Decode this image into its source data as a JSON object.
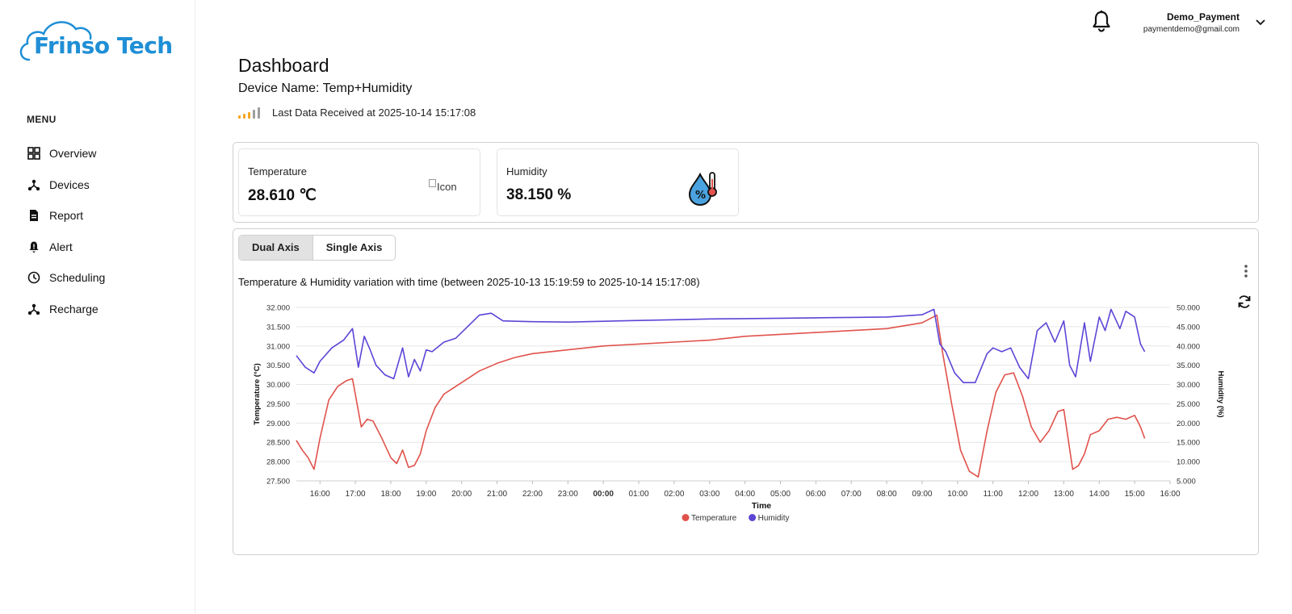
{
  "brand": {
    "name": "Frinso Tech",
    "color": "#1f8fd6"
  },
  "sidebar": {
    "menu_title": "MENU",
    "items": [
      {
        "label": "Overview",
        "icon": "grid-icon"
      },
      {
        "label": "Devices",
        "icon": "devices-icon"
      },
      {
        "label": "Report",
        "icon": "report-icon"
      },
      {
        "label": "Alert",
        "icon": "alert-icon"
      },
      {
        "label": "Scheduling",
        "icon": "clock-icon"
      },
      {
        "label": "Recharge",
        "icon": "recharge-icon"
      }
    ]
  },
  "header": {
    "user_name": "Demo_Payment",
    "user_email": "paymentdemo@gmail.com"
  },
  "main": {
    "title": "Dashboard",
    "device_name": "Device Name: Temp+Humidity",
    "last_data": "Last Data Received at 2025-10-14 15:17:08",
    "signal_colors": [
      "#f5a623",
      "#f5a623",
      "#f5a623",
      "#9e9e9e",
      "#9e9e9e"
    ]
  },
  "cards": [
    {
      "title": "Temperature",
      "value": "28.610 ℃",
      "icon_alt": "Icon"
    },
    {
      "title": "Humidity",
      "value": "38.150 %",
      "icon": "humidity-drop-icon"
    }
  ],
  "tabs": [
    {
      "label": "Dual Axis",
      "active": true
    },
    {
      "label": "Single Axis",
      "active": false
    }
  ],
  "chart_data": {
    "type": "line",
    "title": "Temperature & Humidity variation with time (between 2025-10-13 15:19:59 to 2025-10-14 15:17:08)",
    "xlabel": "Time",
    "ylabel_left": "Temperature (°C)",
    "ylabel_right": "Humidity (%)",
    "x_ticks": [
      "16:00",
      "17:00",
      "18:00",
      "19:00",
      "20:00",
      "21:00",
      "22:00",
      "23:00",
      "00:00",
      "01:00",
      "02:00",
      "03:00",
      "04:00",
      "05:00",
      "06:00",
      "07:00",
      "08:00",
      "09:00",
      "10:00",
      "11:00",
      "12:00",
      "13:00",
      "14:00",
      "15:00",
      "16:00"
    ],
    "y_left_ticks": [
      "32.000",
      "31.500",
      "31.000",
      "30.500",
      "30.000",
      "29.500",
      "29.000",
      "28.500",
      "28.000",
      "27.500"
    ],
    "y_right_ticks": [
      "50.000",
      "45.000",
      "40.000",
      "35.000",
      "30.000",
      "25.000",
      "20.000",
      "15.000",
      "10.000",
      "5.000"
    ],
    "ylim_left": [
      27.5,
      32.0
    ],
    "ylim_right": [
      5,
      50
    ],
    "xlim": [
      "2025-10-13 15:20",
      "2025-10-14 16:00"
    ],
    "grid": true,
    "legend_position": "bottom",
    "series": [
      {
        "name": "Temperature",
        "axis": "left",
        "color": "#e0524b",
        "x": [
          "2025-10-13 15:20",
          "2025-10-13 15:30",
          "2025-10-13 15:40",
          "2025-10-13 15:50",
          "2025-10-13 16:00",
          "2025-10-13 16:15",
          "2025-10-13 16:30",
          "2025-10-13 16:45",
          "2025-10-13 16:55",
          "2025-10-13 17:10",
          "2025-10-13 17:20",
          "2025-10-13 17:30",
          "2025-10-13 17:45",
          "2025-10-13 18:00",
          "2025-10-13 18:10",
          "2025-10-13 18:20",
          "2025-10-13 18:30",
          "2025-10-13 18:40",
          "2025-10-13 18:50",
          "2025-10-13 19:00",
          "2025-10-13 19:15",
          "2025-10-13 19:30",
          "2025-10-13 19:45",
          "2025-10-13 20:00",
          "2025-10-13 20:30",
          "2025-10-13 21:00",
          "2025-10-13 21:30",
          "2025-10-13 22:00",
          "2025-10-13 23:00",
          "2025-10-14 00:00",
          "2025-10-14 01:00",
          "2025-10-14 02:00",
          "2025-10-14 03:00",
          "2025-10-14 04:00",
          "2025-10-14 05:00",
          "2025-10-14 06:00",
          "2025-10-14 07:00",
          "2025-10-14 08:00",
          "2025-10-14 09:00",
          "2025-10-14 09:25",
          "2025-10-14 09:35",
          "2025-10-14 09:50",
          "2025-10-14 10:05",
          "2025-10-14 10:20",
          "2025-10-14 10:35",
          "2025-10-14 10:50",
          "2025-10-14 11:05",
          "2025-10-14 11:20",
          "2025-10-14 11:35",
          "2025-10-14 11:50",
          "2025-10-14 12:05",
          "2025-10-14 12:20",
          "2025-10-14 12:35",
          "2025-10-14 12:50",
          "2025-10-14 13:00",
          "2025-10-14 13:15",
          "2025-10-14 13:25",
          "2025-10-14 13:35",
          "2025-10-14 13:45",
          "2025-10-14 14:00",
          "2025-10-14 14:15",
          "2025-10-14 14:30",
          "2025-10-14 14:45",
          "2025-10-14 15:00",
          "2025-10-14 15:10",
          "2025-10-14 15:17"
        ],
        "values": [
          28.55,
          28.3,
          28.1,
          27.8,
          28.6,
          29.6,
          29.95,
          30.1,
          30.15,
          28.9,
          29.1,
          29.05,
          28.6,
          28.1,
          27.95,
          28.3,
          27.85,
          27.9,
          28.2,
          28.8,
          29.4,
          29.75,
          29.9,
          30.05,
          30.35,
          30.55,
          30.7,
          30.8,
          30.9,
          31.0,
          31.05,
          31.1,
          31.15,
          31.25,
          31.3,
          31.35,
          31.4,
          31.45,
          31.6,
          31.8,
          30.8,
          29.5,
          28.3,
          27.75,
          27.6,
          28.8,
          29.8,
          30.25,
          30.3,
          29.7,
          28.9,
          28.5,
          28.8,
          29.3,
          29.35,
          27.8,
          27.9,
          28.2,
          28.7,
          28.8,
          29.1,
          29.15,
          29.1,
          29.2,
          28.9,
          28.6
        ]
      },
      {
        "name": "Humidity",
        "axis": "right",
        "color": "#5b46d6",
        "x": [
          "2025-10-13 15:20",
          "2025-10-13 15:35",
          "2025-10-13 15:50",
          "2025-10-13 16:00",
          "2025-10-13 16:20",
          "2025-10-13 16:40",
          "2025-10-13 16:55",
          "2025-10-13 17:05",
          "2025-10-13 17:15",
          "2025-10-13 17:25",
          "2025-10-13 17:35",
          "2025-10-13 17:50",
          "2025-10-13 18:05",
          "2025-10-13 18:20",
          "2025-10-13 18:30",
          "2025-10-13 18:40",
          "2025-10-13 18:50",
          "2025-10-13 19:00",
          "2025-10-13 19:10",
          "2025-10-13 19:30",
          "2025-10-13 19:50",
          "2025-10-13 20:10",
          "2025-10-13 20:30",
          "2025-10-13 20:50",
          "2025-10-13 21:10",
          "2025-10-13 22:00",
          "2025-10-13 23:00",
          "2025-10-14 00:00",
          "2025-10-14 01:00",
          "2025-10-14 02:00",
          "2025-10-14 03:00",
          "2025-10-14 04:00",
          "2025-10-14 05:00",
          "2025-10-14 06:00",
          "2025-10-14 07:00",
          "2025-10-14 08:00",
          "2025-10-14 09:00",
          "2025-10-14 09:20",
          "2025-10-14 09:30",
          "2025-10-14 09:40",
          "2025-10-14 09:55",
          "2025-10-14 10:10",
          "2025-10-14 10:30",
          "2025-10-14 10:50",
          "2025-10-14 11:00",
          "2025-10-14 11:15",
          "2025-10-14 11:30",
          "2025-10-14 11:45",
          "2025-10-14 12:00",
          "2025-10-14 12:15",
          "2025-10-14 12:30",
          "2025-10-14 12:45",
          "2025-10-14 13:00",
          "2025-10-14 13:10",
          "2025-10-14 13:20",
          "2025-10-14 13:35",
          "2025-10-14 13:45",
          "2025-10-14 14:00",
          "2025-10-14 14:10",
          "2025-10-14 14:20",
          "2025-10-14 14:35",
          "2025-10-14 14:45",
          "2025-10-14 15:00",
          "2025-10-14 15:10",
          "2025-10-14 15:17"
        ],
        "values": [
          37.5,
          34.5,
          33.0,
          36.0,
          39.5,
          41.5,
          44.5,
          34.5,
          42.5,
          39.0,
          35.0,
          32.5,
          31.5,
          39.5,
          32.0,
          36.5,
          33.5,
          39.0,
          38.5,
          41.0,
          42.0,
          45.0,
          48.0,
          48.5,
          46.5,
          46.3,
          46.2,
          46.4,
          46.6,
          46.8,
          47.0,
          47.1,
          47.2,
          47.3,
          47.4,
          47.5,
          48.1,
          49.5,
          40.5,
          38.5,
          33.0,
          30.5,
          30.5,
          38.0,
          39.5,
          38.5,
          39.5,
          34.5,
          31.5,
          44.0,
          46.0,
          41.0,
          46.5,
          35.0,
          32.0,
          46.0,
          36.0,
          47.5,
          44.0,
          49.5,
          44.5,
          49.0,
          47.5,
          40.5,
          38.5
        ]
      }
    ]
  }
}
